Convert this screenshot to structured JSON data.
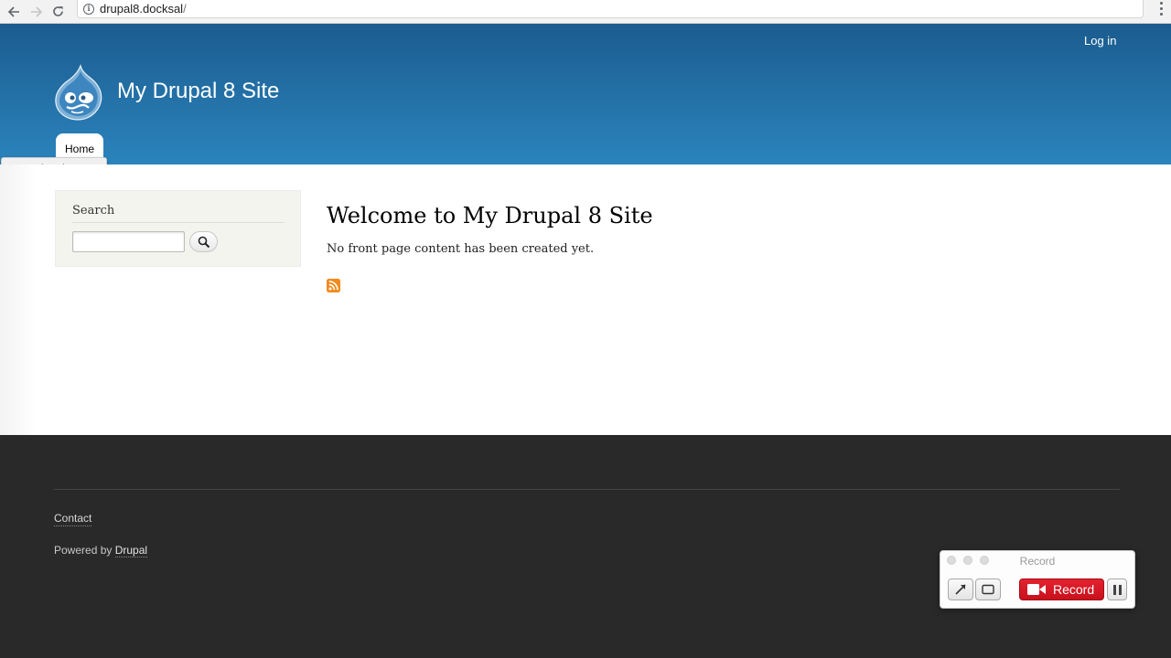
{
  "browser": {
    "url_host": "drupal8.docksal",
    "url_path": "/",
    "back_icon": "arrow-left-icon",
    "forward_icon": "arrow-right-icon",
    "reload_icon": "reload-icon",
    "menu_icon": "vertical-dots-icon"
  },
  "header": {
    "site_name": "My Drupal 8 Site",
    "login_label": "Log in",
    "nav": [
      {
        "label": "Home"
      }
    ],
    "background_top": "#1b5c8f",
    "background_bottom": "#2b84bd"
  },
  "tooltip": {
    "text": "Google Chrome"
  },
  "sidebar": {
    "search_title": "Search",
    "search_placeholder": ""
  },
  "content": {
    "title": "Welcome to My Drupal 8 Site",
    "description": "No front page content has been created yet.",
    "feed_icon": "rss-icon"
  },
  "footer": {
    "contact_label": "Contact",
    "powered_prefix": "Powered by ",
    "powered_link": "Drupal",
    "background": "#292929"
  },
  "recorder": {
    "title": "Record",
    "record_label": "Record",
    "record_color": "#d81a26"
  }
}
